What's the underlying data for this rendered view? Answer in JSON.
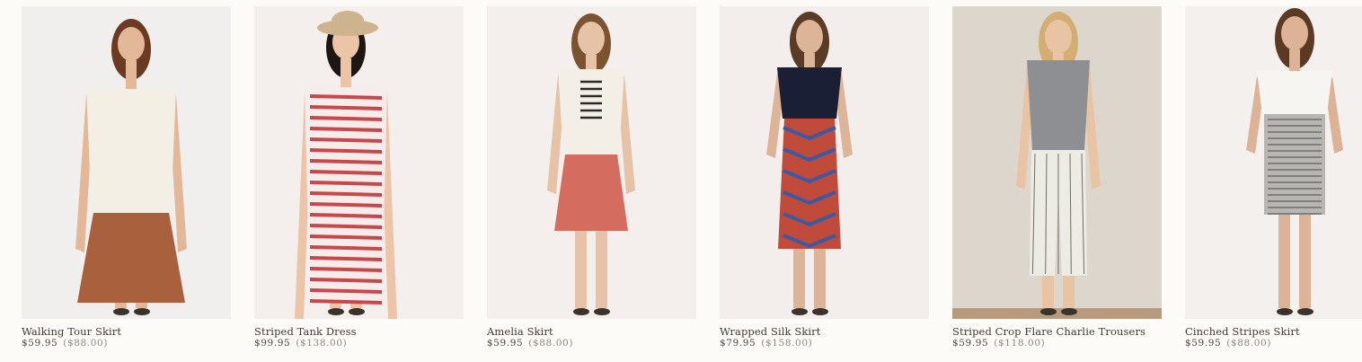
{
  "products": [
    {
      "name": "Walking Tour Skirt",
      "sale_price": "$59.95",
      "original_price": "($88.00)",
      "colors": {
        "background": "#f1efed",
        "skin": "#e2b898",
        "hair": "#6b3a23",
        "top": "#f4efe4",
        "bottom": "#a9603c"
      }
    },
    {
      "name": "Striped Tank Dress",
      "sale_price": "$99.95",
      "original_price": "($138.00)",
      "colors": {
        "background": "#f4efed",
        "skin": "#ecc5a8",
        "hair": "#1d1612",
        "top": "#f6ecec",
        "bottom": "#c8474a",
        "hat": "#cdb48f"
      }
    },
    {
      "name": "Amelia Skirt",
      "sale_price": "$59.95",
      "original_price": "($88.00)",
      "colors": {
        "background": "#f4efed",
        "skin": "#e6c2a6",
        "hair": "#7b5331",
        "top": "#f3efe6",
        "bottom": "#d46c5f",
        "accent": "#2a2a2a"
      }
    },
    {
      "name": "Wrapped Silk Skirt",
      "sale_price": "$79.95",
      "original_price": "($158.00)",
      "colors": {
        "background": "#f3eeeb",
        "skin": "#dcb497",
        "hair": "#5a3b25",
        "top": "#1a1f35",
        "bottom": "#c14b3a",
        "accent": "#3a5aa3"
      }
    },
    {
      "name": "Striped Crop Flare Charlie Trousers",
      "sale_price": "$59.95",
      "original_price": "($118.00)",
      "colors": {
        "background": "#dcd6cc",
        "skin": "#e8c3a4",
        "hair": "#d3ad72",
        "top": "#8e8f92",
        "bottom": "#ecebe4",
        "floor": "#b89a7e"
      }
    },
    {
      "name": "Cinched Stripes Skirt",
      "sale_price": "$59.95",
      "original_price": "($88.00)",
      "colors": {
        "background": "#f4f0ee",
        "skin": "#dcb397",
        "hair": "#5b3a24",
        "top": "#f7f5f1",
        "bottom": "#b8b6b2",
        "accent": "#7a8794"
      }
    }
  ]
}
